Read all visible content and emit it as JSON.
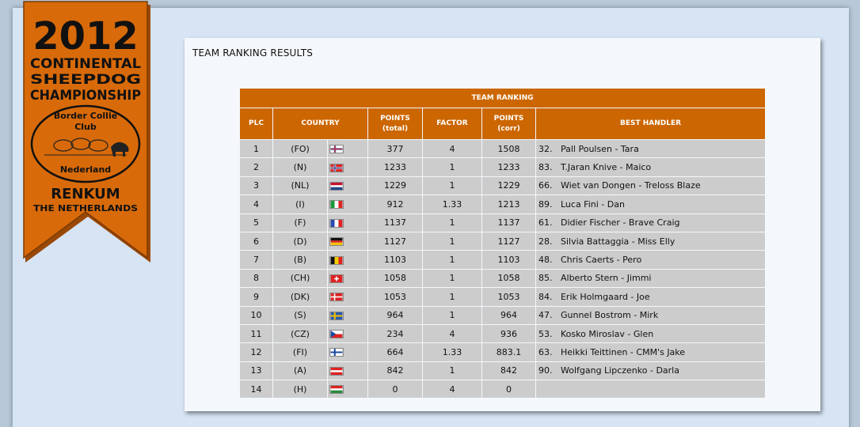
{
  "banner": {
    "year": "2012",
    "line1": "CONTINENTAL",
    "line2": "SHEEPDOG",
    "line3": "CHAMPIONSHIP",
    "club_top": "Border Collie",
    "club_mid": "Club",
    "club_bottom": "Nederland",
    "city": "RENKUM",
    "country": "THE NETHERLANDS",
    "colors": {
      "ribbon": "#d86a0a",
      "ribbon_dark": "#9a4806"
    }
  },
  "page": {
    "section_title": "TEAM RANKING RESULTS"
  },
  "table": {
    "title": "TEAM RANKING",
    "columns": {
      "plc": "PLC",
      "country": "COUNTRY",
      "points_total_1": "POINTS",
      "points_total_2": "(total)",
      "factor": "FACTOR",
      "points_corr_1": "POINTS",
      "points_corr_2": "(corr)",
      "best_handler": "BEST HANDLER"
    },
    "header_color": "#cc6600",
    "rows": [
      {
        "plc": "1",
        "code": "(FO)",
        "flag": "flag-faroe-icon",
        "total": "377",
        "factor": "4",
        "corr": "1508",
        "handler": "32.   Pall Poulsen - Tara"
      },
      {
        "plc": "2",
        "code": "(N)",
        "flag": "flag-norway-icon",
        "total": "1233",
        "factor": "1",
        "corr": "1233",
        "handler": "83.   T.Jaran Knive - Maico"
      },
      {
        "plc": "3",
        "code": "(NL)",
        "flag": "flag-netherlands-icon",
        "total": "1229",
        "factor": "1",
        "corr": "1229",
        "handler": "66.   Wiet van Dongen - Treloss Blaze"
      },
      {
        "plc": "4",
        "code": "(I)",
        "flag": "flag-italy-icon",
        "total": "912",
        "factor": "1.33",
        "corr": "1213",
        "handler": "89.   Luca Fini - Dan"
      },
      {
        "plc": "5",
        "code": "(F)",
        "flag": "flag-france-icon",
        "total": "1137",
        "factor": "1",
        "corr": "1137",
        "handler": "61.   Didier Fischer - Brave Craig"
      },
      {
        "plc": "6",
        "code": "(D)",
        "flag": "flag-germany-icon",
        "total": "1127",
        "factor": "1",
        "corr": "1127",
        "handler": "28.   Silvia Battaggia - Miss Elly"
      },
      {
        "plc": "7",
        "code": "(B)",
        "flag": "flag-belgium-icon",
        "total": "1103",
        "factor": "1",
        "corr": "1103",
        "handler": "48.   Chris Caerts - Pero"
      },
      {
        "plc": "8",
        "code": "(CH)",
        "flag": "flag-switzerland-icon",
        "total": "1058",
        "factor": "1",
        "corr": "1058",
        "handler": "85.   Alberto Stern - Jimmi"
      },
      {
        "plc": "9",
        "code": "(DK)",
        "flag": "flag-denmark-icon",
        "total": "1053",
        "factor": "1",
        "corr": "1053",
        "handler": "84.   Erik Holmgaard - Joe"
      },
      {
        "plc": "10",
        "code": "(S)",
        "flag": "flag-sweden-icon",
        "total": "964",
        "factor": "1",
        "corr": "964",
        "handler": "47.   Gunnel Bostrom - Mirk"
      },
      {
        "plc": "11",
        "code": "(CZ)",
        "flag": "flag-czech-icon",
        "total": "234",
        "factor": "4",
        "corr": "936",
        "handler": "53.   Kosko Miroslav - Glen"
      },
      {
        "plc": "12",
        "code": "(FI)",
        "flag": "flag-finland-icon",
        "total": "664",
        "factor": "1.33",
        "corr": "883.1",
        "handler": "63.   Heikki Teittinen - CMM's Jake"
      },
      {
        "plc": "13",
        "code": "(A)",
        "flag": "flag-austria-icon",
        "total": "842",
        "factor": "1",
        "corr": "842",
        "handler": "90.   Wolfgang Lipczenko - Darla"
      },
      {
        "plc": "14",
        "code": "(H)",
        "flag": "flag-hungary-icon",
        "total": "0",
        "factor": "4",
        "corr": "0",
        "handler": ""
      }
    ]
  }
}
